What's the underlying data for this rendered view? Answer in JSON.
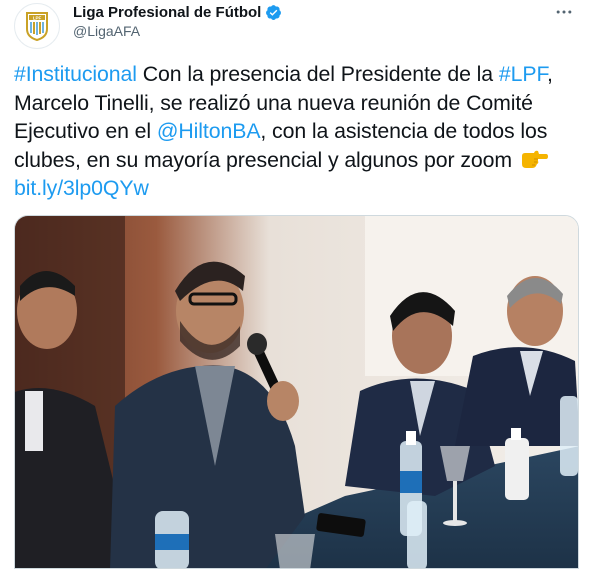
{
  "account": {
    "display_name": "Liga Profesional de Fútbol",
    "handle": "@LigaAFA",
    "avatar_text": "LPF",
    "verified": true
  },
  "tweet": {
    "segments": [
      {
        "type": "link",
        "text": "#Institucional"
      },
      {
        "type": "text",
        "text": " Con la presencia del Presidente de la "
      },
      {
        "type": "link",
        "text": "#LPF"
      },
      {
        "type": "text",
        "text": ", Marcelo Tinelli, se realizó una nueva reunión de Comité Ejecutivo en el "
      },
      {
        "type": "link",
        "text": "@HiltonBA"
      },
      {
        "type": "text",
        "text": ", con la asistencia de todos los clubes, en su mayoría presencial y algunos por zoom "
      },
      {
        "type": "emoji",
        "name": "backhand-index-pointing-right-emoji"
      },
      {
        "type": "link",
        "text": "bit.ly/3lp0QYw"
      }
    ]
  },
  "icons": {
    "verified": "verified-badge-icon",
    "more": "more-options-icon",
    "avatar": "lpf-logo"
  },
  "colors": {
    "link": "#1d9bf0",
    "text": "#0f1419",
    "secondary": "#536471",
    "verified": "#1d9bf0",
    "logo_gold": "#c9a227",
    "logo_blue": "#6fb3e0"
  }
}
